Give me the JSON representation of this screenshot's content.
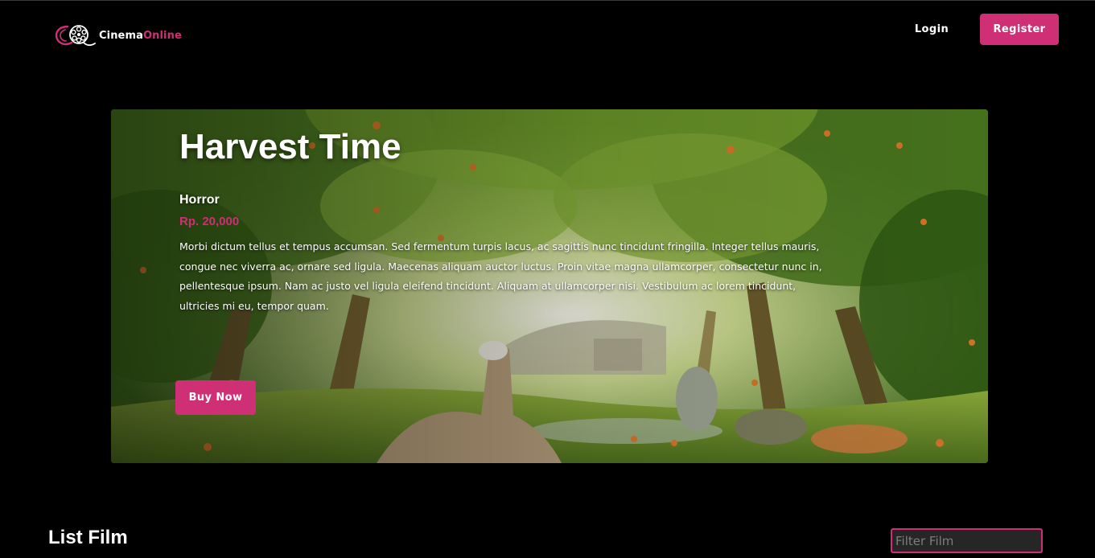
{
  "brand": {
    "name_part1": "Cinema",
    "name_part2": "Online",
    "logo_icon": "film-reel-logo-icon",
    "accent_color": "#cf2f74"
  },
  "nav": {
    "login_label": "Login",
    "register_label": "Register"
  },
  "hero": {
    "title": "Harvest Time",
    "genre": "Horror",
    "price": "Rp. 20,000",
    "description": "Morbi dictum tellus et tempus accumsan. Sed fermentum turpis lacus, ac sagittis nunc tincidunt fringilla. Integer tellus mauris, congue nec viverra ac, ornare sed ligula. Maecenas aliquam auctor luctus. Proin vitae magna ullamcorper, consectetur nunc in, pellentesque ipsum. Nam ac justo vel ligula eleifend tincidunt. Aliquam at ullamcorper nisi. Vestibulum ac lorem tincidunt, ultricies mi eu, tempor quam.",
    "buy_label": "Buy Now"
  },
  "list": {
    "title": "List Film",
    "filter_placeholder": "Filter Film"
  }
}
